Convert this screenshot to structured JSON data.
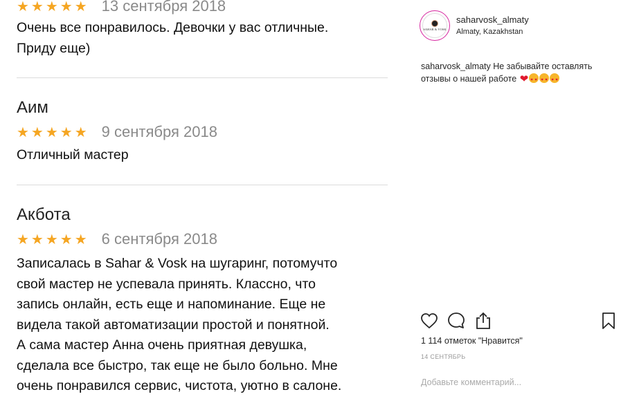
{
  "reviews": [
    {
      "name": "",
      "stars": "★★★★★",
      "date": "13 сентября 2018",
      "text": [
        "Очень все понравилось. Девочки у вас отличные.",
        "Приду еще)"
      ]
    },
    {
      "name": "Аим",
      "stars": "★★★★★",
      "date": "9 сентября 2018",
      "text": [
        "Отличный мастер"
      ]
    },
    {
      "name": "Акбота",
      "stars": "★★★★★",
      "date": "6 сентября 2018",
      "text": [
        "Записалась в Sahar & Vosk на шугаринг, потомучто",
        "свой мастер не успевала принять. Классно, что",
        "запись онлайн, есть еще и напоминание. Еще не",
        "видела такой автоматизации простой и понятной.",
        "А сама мастер Анна очень приятная девушка,",
        "сделала все быстро, так еще не было больно. Мне",
        "очень понравился сервис, чистота, уютно в салоне."
      ]
    }
  ],
  "post": {
    "avatar_text": "SAHAR & VOSK",
    "username": "saharvosk_almaty",
    "location": "Almaty, Kazakhstan",
    "caption_user": "saharvosk_almaty",
    "caption_text": "Не забывайте оставлять отзывы о нашей работе",
    "caption_emoji": [
      "red-heart",
      "heart-eyes-face",
      "heart-eyes-face",
      "heart-eyes-face"
    ],
    "likes": "1 114 отметок \"Нравится\"",
    "time": "14 СЕНТЯБРЬ",
    "comment_placeholder": "Добавьте комментарий..."
  },
  "icons": [
    "like-heart-icon",
    "comment-icon",
    "share-icon",
    "bookmark-icon"
  ],
  "colors": {
    "stars": "#f5a623",
    "divider": "#dcdcdc",
    "heart": "#e0182d"
  }
}
